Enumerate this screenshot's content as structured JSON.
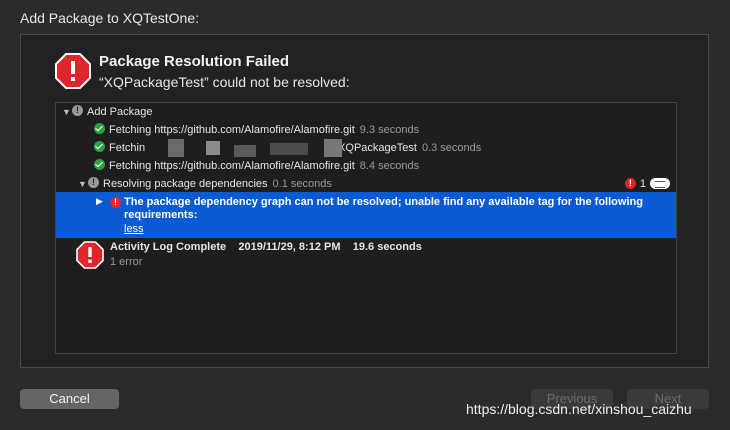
{
  "window": {
    "title": "Add Package to XQTestOne:"
  },
  "dialog": {
    "heading": "Package Resolution Failed",
    "subheading": "“XQPackageTest” could not be resolved:"
  },
  "log": {
    "root": {
      "label": "Add Package"
    },
    "fetch_rows": [
      {
        "text": "Fetching https://github.com/Alamofire/Alamofire.git",
        "duration": "9.3 seconds"
      },
      {
        "text_start": "Fetchin",
        "text_end": "XQPackageTest",
        "duration": "0.3 seconds"
      },
      {
        "text": "Fetching https://github.com/Alamofire/Alamofire.git",
        "duration": "8.4 seconds"
      }
    ],
    "resolving": {
      "text": "Resolving package dependencies",
      "duration": "0.1 seconds",
      "error_count": "1"
    },
    "error_message": {
      "text": "The package dependency graph can not be resolved; unable find any available tag for the following requirements:",
      "link": "less"
    },
    "complete": {
      "title": "Activity Log Complete",
      "date": "2019/11/29, 8:12 PM",
      "duration": "19.6 seconds",
      "summary": "1 error"
    }
  },
  "footer": {
    "cancel_label": "Cancel",
    "previous_label": "Previous",
    "next_label": "Next"
  },
  "watermark": "https://blog.csdn.net/xinshou_caizhu",
  "colors": {
    "selection": "#0a5bd3",
    "error": "#e0262b",
    "success": "#2ea043"
  }
}
